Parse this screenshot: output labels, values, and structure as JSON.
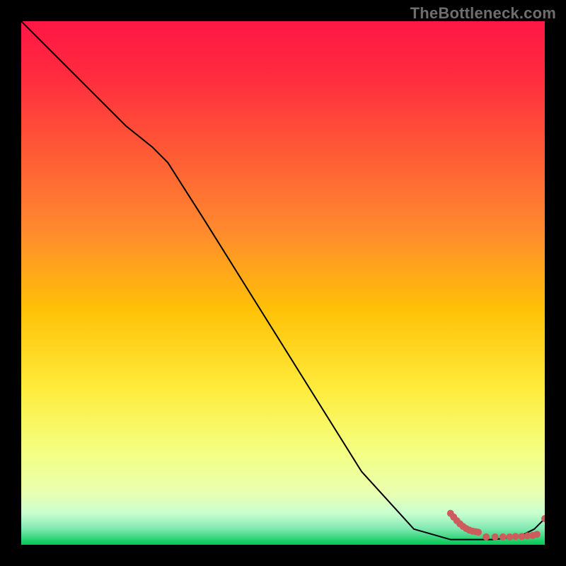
{
  "watermark": "TheBottleneck.com",
  "chart_data": {
    "type": "line",
    "title": "",
    "xlabel": "",
    "ylabel": "",
    "xlim": [
      0,
      100
    ],
    "ylim": [
      0,
      100
    ],
    "grid": false,
    "legend": false,
    "curve": {
      "name": "main-curve",
      "x": [
        0,
        5,
        10,
        15,
        20,
        25,
        28,
        35,
        45,
        55,
        65,
        75,
        82,
        85,
        88,
        90,
        92,
        94,
        96,
        98,
        100
      ],
      "y": [
        100,
        95,
        90,
        85,
        80,
        76,
        73,
        62,
        46,
        30,
        14,
        3,
        1,
        1,
        1,
        1,
        1.2,
        1.5,
        2,
        3,
        5
      ]
    },
    "markers": {
      "name": "highlight-points",
      "color": "#cd5c5c",
      "clusterA_x": [
        82.0,
        82.6,
        83.2,
        83.8,
        84.4,
        85.0,
        85.6,
        86.2,
        86.8,
        87.3
      ],
      "clusterA_y": [
        6.0,
        5.3,
        4.6,
        4.0,
        3.5,
        3.1,
        2.8,
        2.6,
        2.5,
        2.4
      ],
      "clusterB_x": [
        88.8,
        90.5,
        92.0,
        93.3,
        94.4,
        95.6,
        96.7,
        97.7,
        98.5,
        100
      ],
      "clusterB_y": [
        1.5,
        1.5,
        1.5,
        1.5,
        1.6,
        1.6,
        1.7,
        1.8,
        2.0,
        5.0
      ]
    },
    "gradient_stops": [
      {
        "offset": 0.0,
        "color": "#ff1744"
      },
      {
        "offset": 0.1,
        "color": "#ff2a3f"
      },
      {
        "offset": 0.25,
        "color": "#ff5a36"
      },
      {
        "offset": 0.4,
        "color": "#ff8a2e"
      },
      {
        "offset": 0.55,
        "color": "#ffc107"
      },
      {
        "offset": 0.7,
        "color": "#ffeb3b"
      },
      {
        "offset": 0.82,
        "color": "#f4ff81"
      },
      {
        "offset": 0.9,
        "color": "#eaffb0"
      },
      {
        "offset": 0.94,
        "color": "#c8ffd0"
      },
      {
        "offset": 0.97,
        "color": "#7ee8b0"
      },
      {
        "offset": 1.0,
        "color": "#00c853"
      }
    ]
  }
}
